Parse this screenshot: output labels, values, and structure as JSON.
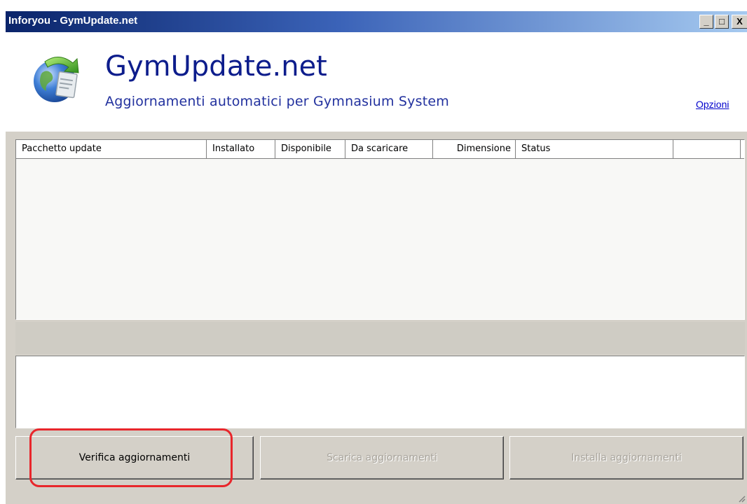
{
  "window": {
    "title": "Inforyou - GymUpdate.net",
    "controls": {
      "minimize": "_",
      "maximize": "□",
      "close": "X"
    }
  },
  "header": {
    "app_name": "GymUpdate.net",
    "subtitle": "Aggiornamenti automatici per Gymnasium System",
    "options_link": "Opzioni",
    "logo_icon": "globe-update-icon"
  },
  "table": {
    "columns": [
      "Pacchetto update",
      "Installato",
      "Disponibile",
      "Da scaricare",
      "Dimensione",
      "Status",
      ""
    ],
    "rows": []
  },
  "log": {
    "text": ""
  },
  "buttons": {
    "check": {
      "label": "Verifica aggiornamenti",
      "enabled": true
    },
    "download": {
      "label": "Scarica aggiornamenti",
      "enabled": false
    },
    "install": {
      "label": "Installa aggiornamenti",
      "enabled": false
    }
  },
  "colors": {
    "titlebar_start": "#0a246a",
    "titlebar_end": "#a6caf0",
    "app_title": "#0d1d8c",
    "highlight": "#e8262b",
    "face": "#d4d0c8"
  }
}
